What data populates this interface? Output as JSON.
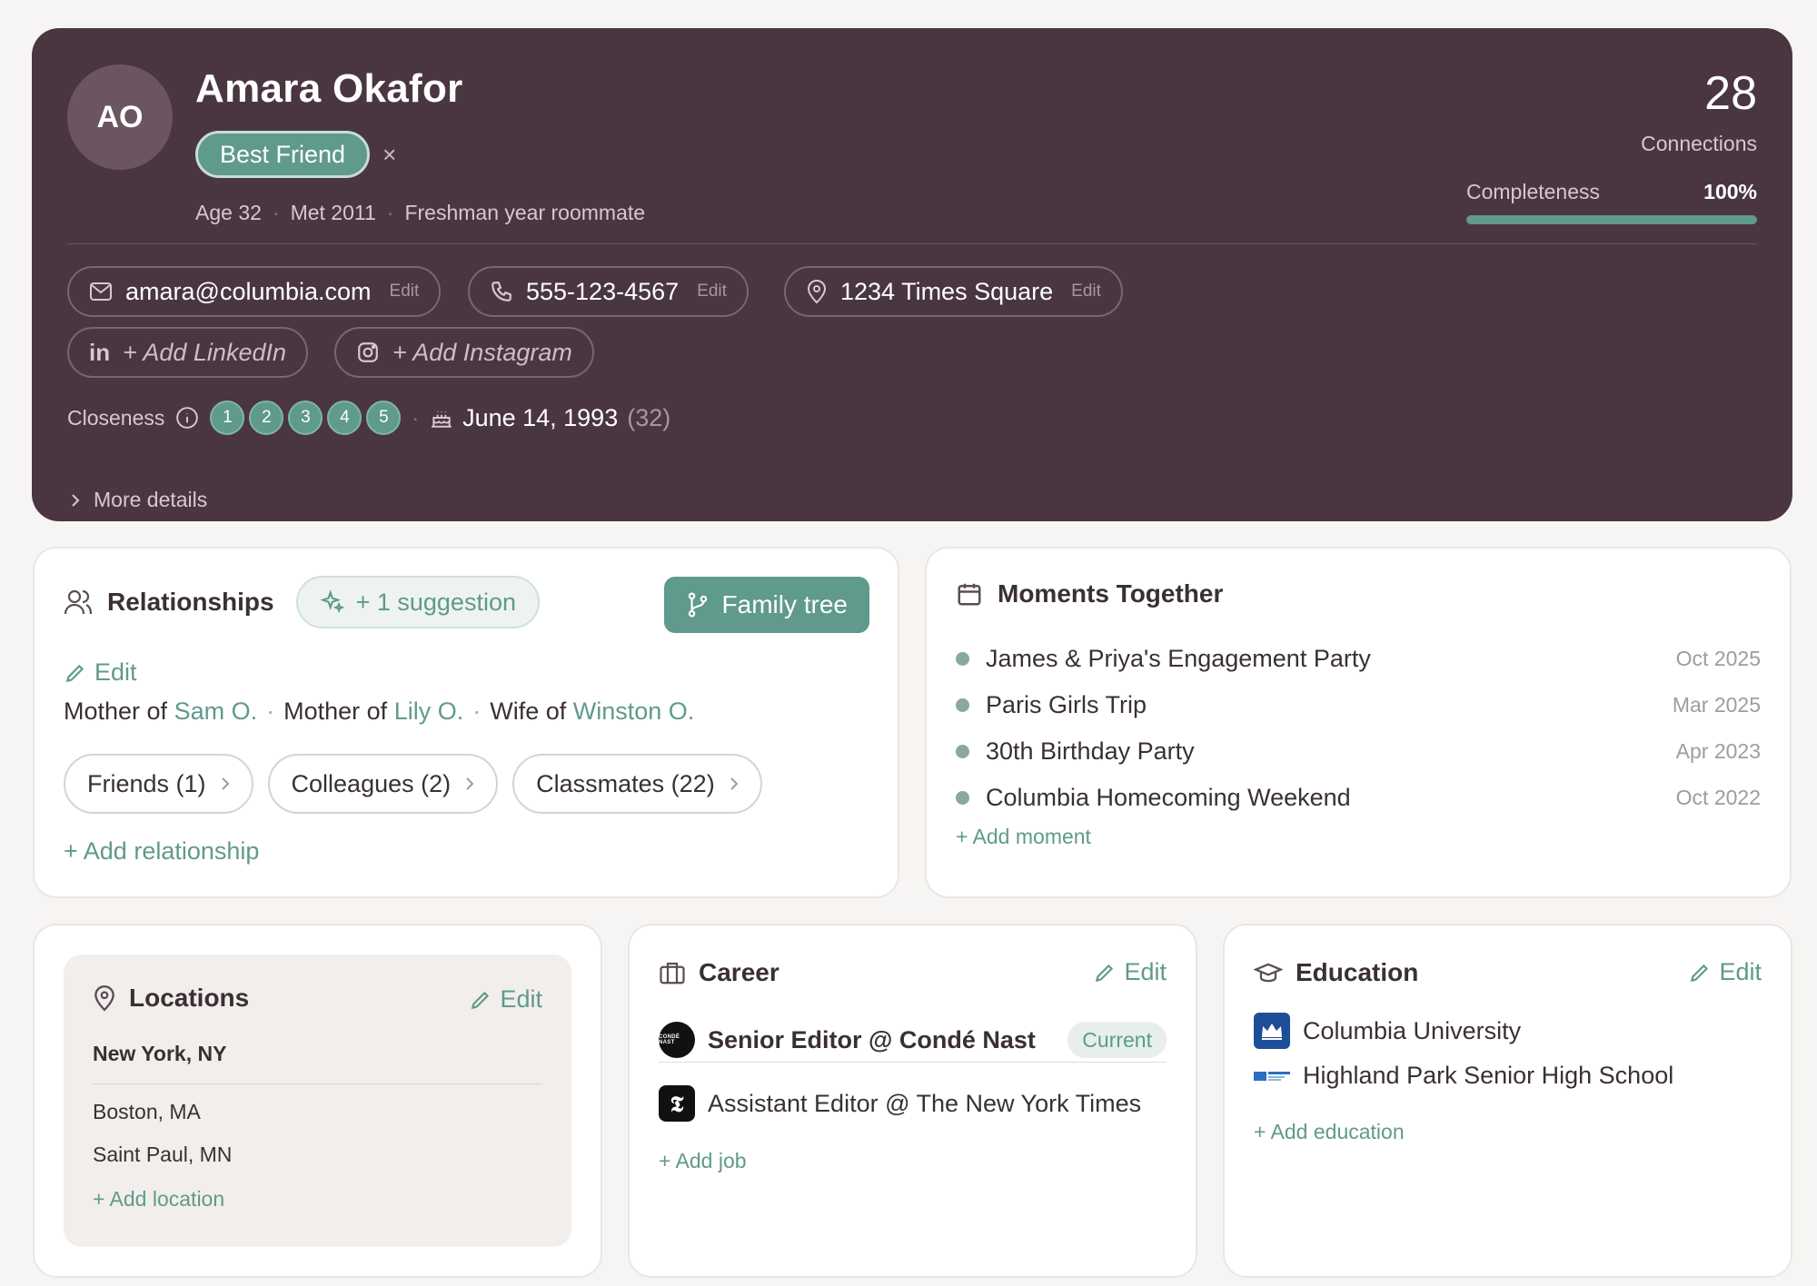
{
  "profile": {
    "initials": "AO",
    "name": "Amara Okafor",
    "badge": "Best Friend",
    "remove_icon": "×",
    "meta": [
      "Age 32",
      "Met 2011",
      "Freshman year roommate"
    ],
    "connections_count": "28",
    "connections_label": "Connections",
    "completeness_label": "Completeness",
    "completeness_value": "100%",
    "completeness_fraction": 1.0
  },
  "contacts": {
    "email": "amara@columbia.com",
    "phone": "555-123-4567",
    "address": "1234 Times Square",
    "edit_label": "Edit",
    "add_linkedin": "+ Add LinkedIn",
    "add_instagram": "+ Add Instagram"
  },
  "closeness": {
    "label": "Closeness",
    "levels": [
      "1",
      "2",
      "3",
      "4",
      "5"
    ],
    "birthday": "June 14, 1993",
    "birthday_age": "(32)",
    "separator": "·"
  },
  "more_details": "More details",
  "relationships": {
    "title": "Relationships",
    "suggestion": "+ 1 suggestion",
    "family_tree": "Family tree",
    "edit": "Edit",
    "links": [
      {
        "prefix": "Mother of",
        "name": "Sam O."
      },
      {
        "prefix": "Mother of",
        "name": "Lily O."
      },
      {
        "prefix": "Wife of",
        "name": "Winston O."
      }
    ],
    "groups": [
      "Friends (1)",
      "Colleagues (2)",
      "Classmates (22)"
    ],
    "add": "+ Add relationship"
  },
  "moments": {
    "title": "Moments Together",
    "items": [
      {
        "title": "James & Priya's Engagement Party",
        "date": "Oct 2025"
      },
      {
        "title": "Paris Girls Trip",
        "date": "Mar 2025"
      },
      {
        "title": "30th Birthday Party",
        "date": "Apr 2023"
      },
      {
        "title": "Columbia Homecoming Weekend",
        "date": "Oct 2022"
      }
    ],
    "add": "+ Add moment"
  },
  "locations": {
    "title": "Locations",
    "edit": "Edit",
    "primary": "New York, NY",
    "others": [
      "Boston, MA",
      "Saint Paul, MN"
    ],
    "add": "+ Add location"
  },
  "career": {
    "title": "Career",
    "edit": "Edit",
    "current_job": "Senior Editor @ Condé Nast",
    "current_label": "Current",
    "current_logo_text": "CONDÉ NAST",
    "past_job": "Assistant Editor @ The New York Times",
    "past_logo_text": "𝕿",
    "add": "+ Add job"
  },
  "education": {
    "title": "Education",
    "edit": "Edit",
    "schools": [
      "Columbia University",
      "Highland Park Senior High School"
    ],
    "add": "+ Add education"
  },
  "colors": {
    "hero_bg": "#4a3640",
    "accent": "#5f9a8c",
    "page_bg": "#f7f5f3"
  }
}
